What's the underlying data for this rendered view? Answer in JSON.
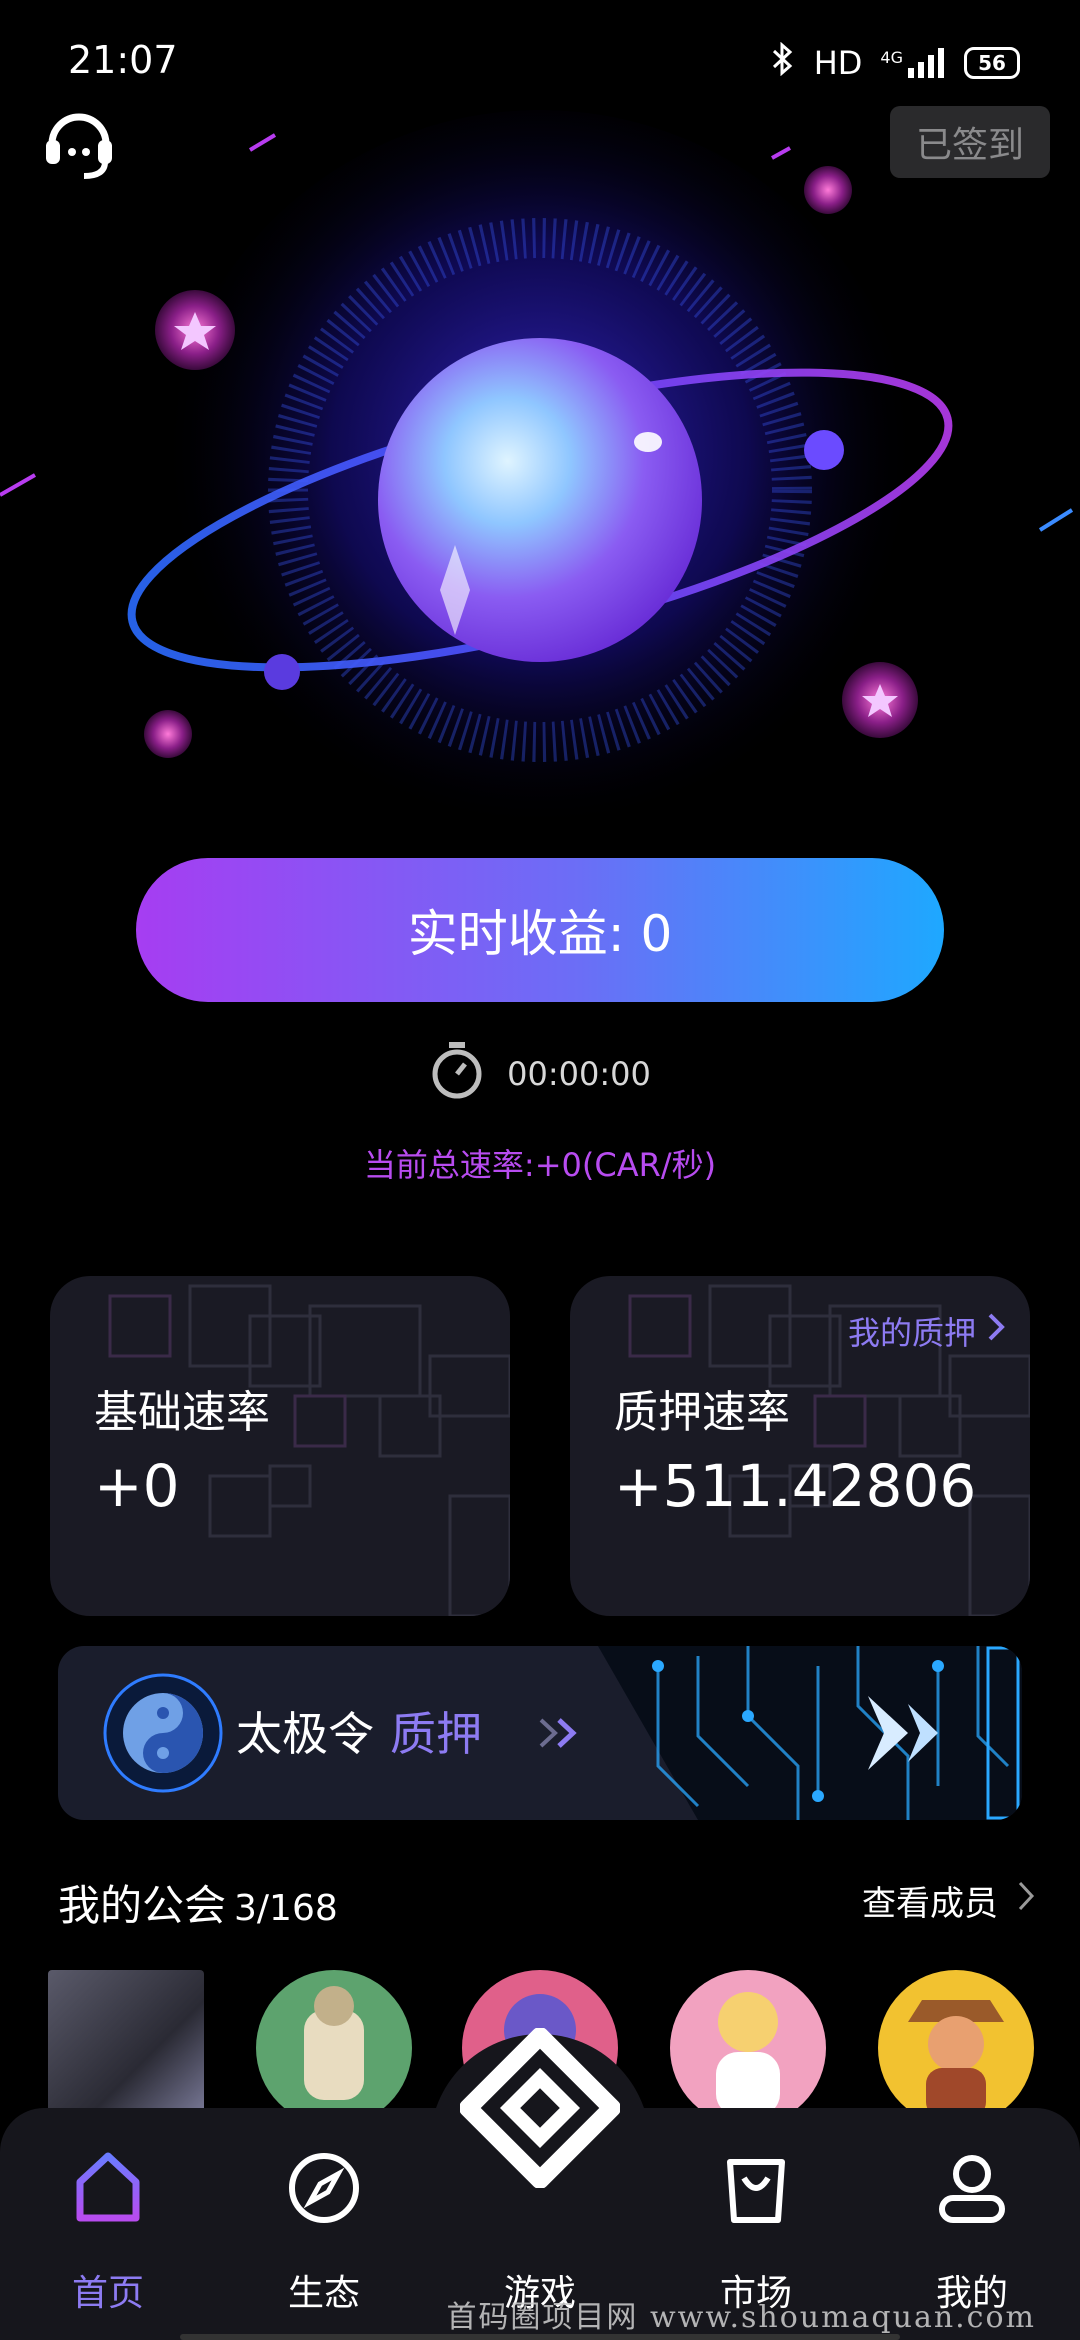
{
  "status_bar": {
    "time": "21:07",
    "network": "HD",
    "signal": "4G",
    "battery": "56"
  },
  "header": {
    "support_icon": "headset-icon",
    "sign_in_label": "已签到"
  },
  "earnings": {
    "label": "实时收益: 0",
    "timer": "00:00:00",
    "total_speed": "当前总速率:+0(CAR/秒)"
  },
  "cards": {
    "base": {
      "title": "基础速率",
      "value": "+0"
    },
    "stake": {
      "title": "质押速率",
      "value": "+511.42806",
      "link": "我的质押"
    }
  },
  "banner": {
    "name": "太极令",
    "action": "质押"
  },
  "guild": {
    "title": "我的公会",
    "count": "3/168",
    "view_members": "查看成员"
  },
  "nav": {
    "items": [
      {
        "label": "首页",
        "icon": "home-icon",
        "active": true
      },
      {
        "label": "生态",
        "icon": "compass-icon",
        "active": false
      },
      {
        "label": "游戏",
        "icon": "game-logo-icon",
        "active": false
      },
      {
        "label": "市场",
        "icon": "shopping-bag-icon",
        "active": false
      },
      {
        "label": "我的",
        "icon": "user-icon",
        "active": false
      }
    ]
  },
  "watermark": "首码圈项目网 www.shoumaquan.com",
  "colors": {
    "accent_purple": "#8d7bf2",
    "speed_purple": "#b84cf0",
    "gradient_start": "#a63df2",
    "gradient_end": "#1ea8ff",
    "card_bg": "#1a1a24",
    "nav_bg": "#16161c"
  }
}
